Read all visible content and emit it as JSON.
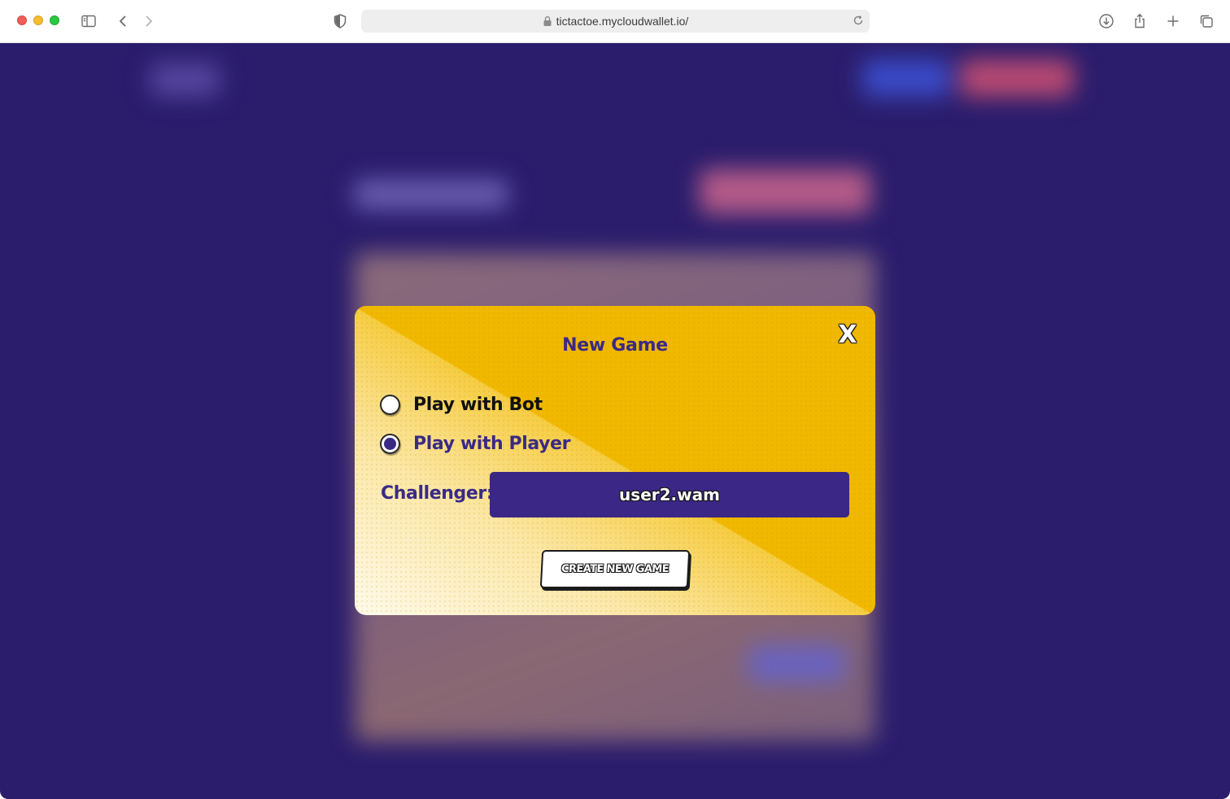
{
  "browser": {
    "url": "tictactoe.mycloudwallet.io/",
    "icons": {
      "sidebar": "sidebar-icon",
      "back": "chevron-left-icon",
      "forward": "chevron-right-icon",
      "privacy": "shield-icon",
      "lock": "lock-icon",
      "reload": "reload-icon",
      "download": "download-icon",
      "share": "share-icon",
      "new_tab": "plus-icon",
      "tabs": "tabs-icon"
    }
  },
  "modal": {
    "title": "New Game",
    "close_label": "X",
    "options": [
      {
        "label": "Play with Bot",
        "selected": false
      },
      {
        "label": "Play with Player",
        "selected": true
      }
    ],
    "challenger_label": "Challenger:",
    "challenger_value": "user2.wam",
    "create_button": "CREATE NEW GAME"
  },
  "colors": {
    "page_background": "#2b1d6c",
    "modal_yellow": "#f1b800",
    "accent_purple": "#3a2a85",
    "input_purple": "#3b2785"
  }
}
